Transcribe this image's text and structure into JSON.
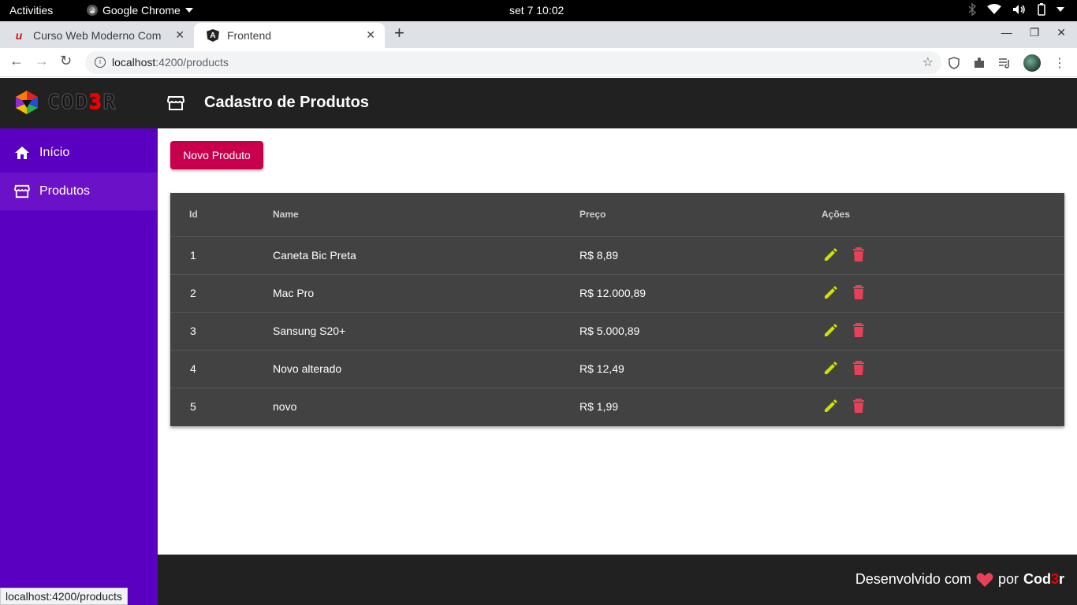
{
  "os": {
    "activities": "Activities",
    "app_menu": "Google Chrome",
    "clock": "set 7  10:02"
  },
  "browser": {
    "tabs": [
      {
        "title": "Curso Web Moderno Com",
        "active": false
      },
      {
        "title": "Frontend",
        "active": true
      }
    ],
    "url_host": "localhost",
    "url_path": ":4200/products",
    "status_url": "localhost:4200/products"
  },
  "header": {
    "logo_text": "COD",
    "logo_accent": "3",
    "logo_end": "R",
    "title": "Cadastro de Produtos"
  },
  "sidebar": {
    "items": [
      {
        "label": "Início",
        "icon": "home-icon"
      },
      {
        "label": "Produtos",
        "icon": "storefront-icon"
      }
    ]
  },
  "main": {
    "new_button": "Novo Produto",
    "table": {
      "headers": {
        "id": "Id",
        "name": "Name",
        "price": "Preço",
        "actions": "Ações"
      },
      "rows": [
        {
          "id": "1",
          "name": "Caneta Bic Preta",
          "price": "R$ 8,89"
        },
        {
          "id": "2",
          "name": "Mac Pro",
          "price": "R$ 12.000,89"
        },
        {
          "id": "3",
          "name": "Sansung S20+",
          "price": "R$ 5.000,89"
        },
        {
          "id": "4",
          "name": "Novo alterado",
          "price": "R$ 12,49"
        },
        {
          "id": "5",
          "name": "novo",
          "price": "R$ 1,99"
        }
      ]
    }
  },
  "footer": {
    "text_before": "Desenvolvido com",
    "text_by": "por",
    "brand_start": "Cod",
    "brand_accent": "3",
    "brand_end": "r"
  },
  "colors": {
    "sidebar": "#5a00c0",
    "header": "#212121",
    "primary_button": "#c8004c",
    "edit_icon": "#d4e000",
    "delete_icon": "#e84057",
    "heart": "#e84057"
  }
}
